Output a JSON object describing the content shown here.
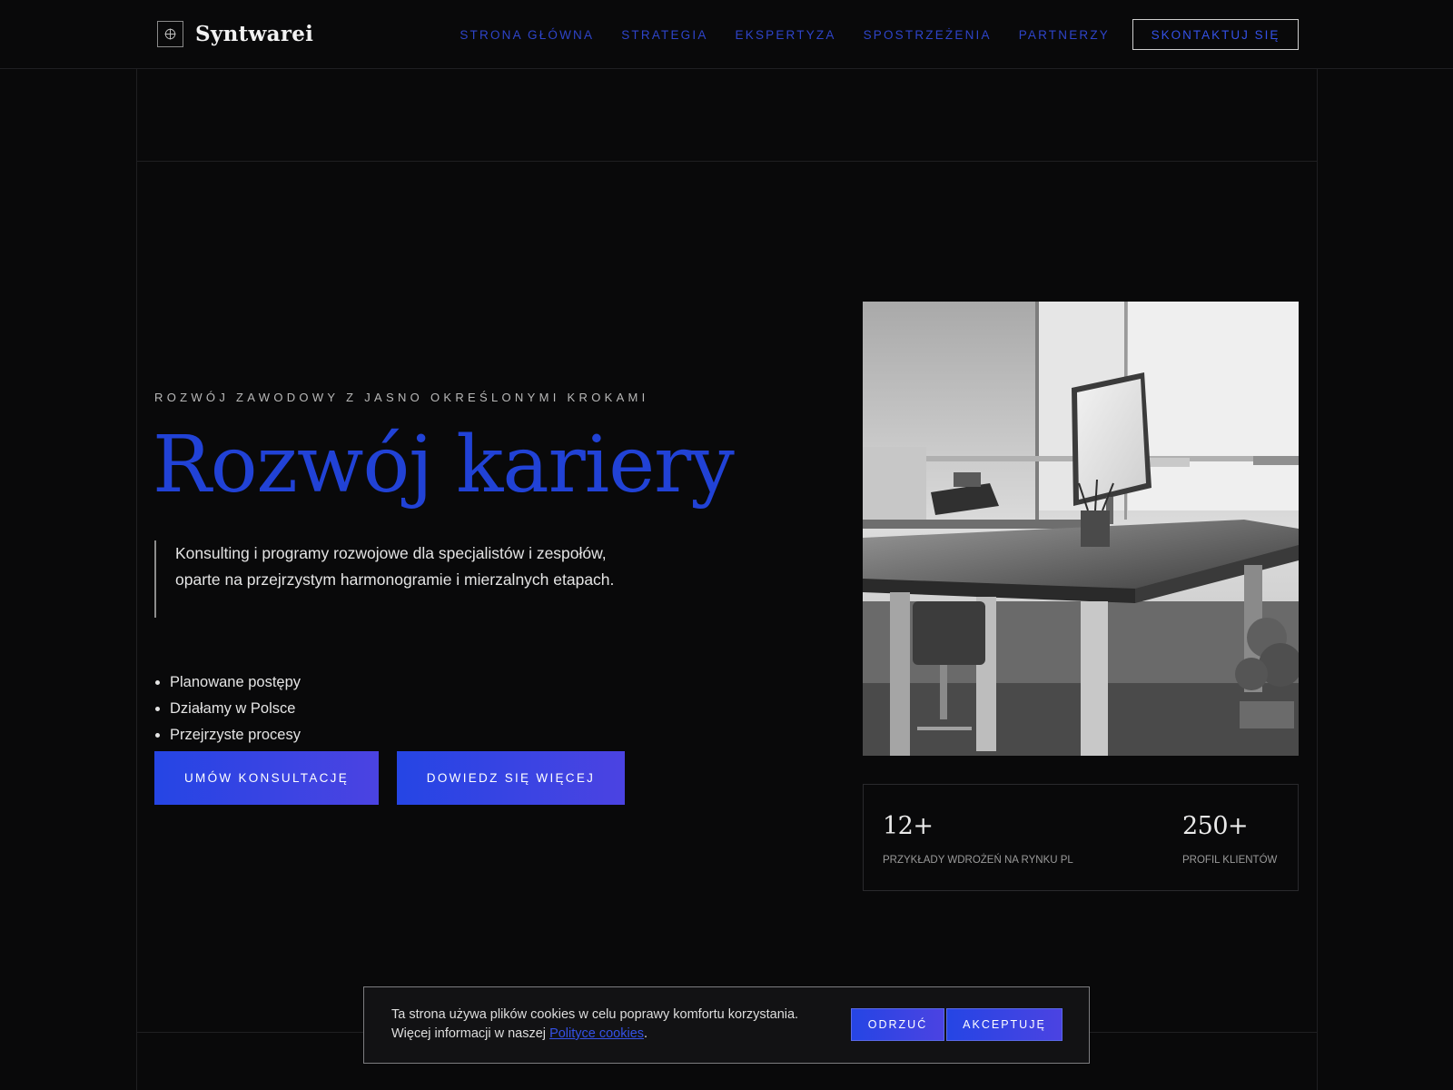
{
  "brand": {
    "name": "Syntwarei",
    "icon": "crosshair-icon"
  },
  "nav": {
    "items": [
      {
        "label": "STRONA GŁÓWNA"
      },
      {
        "label": "STRATEGIA"
      },
      {
        "label": "EKSPERTYZA"
      },
      {
        "label": "SPOSTRZEŻENIA"
      },
      {
        "label": "PARTNERZY"
      }
    ],
    "contact_label": "SKONTAKTUJ SIĘ"
  },
  "hero": {
    "eyebrow": "ROZWÓJ ZAWODOWY Z JASNO OKREŚLONYMI KROKAMI",
    "title": "Rozwój kariery",
    "lead": "Konsulting i programy rozwojowe dla specjalistów i zespołów, oparte na przejrzystym harmonogramie i mierzalnych etapach.",
    "bullets": [
      "Planowane postępy",
      "Działamy w Polsce",
      "Przejrzyste procesy"
    ],
    "primary_button": "UMÓW KONSULTACJĘ",
    "secondary_button": "DOWIEDZ SIĘ WIĘCEJ"
  },
  "stats": [
    {
      "value": "12+",
      "label": "PRZYKŁADY WDROŻEŃ NA RYNKU PL"
    },
    {
      "value": "250+",
      "label": "PROFIL KLIENTÓW"
    }
  ],
  "cookie": {
    "line1": "Ta strona używa plików cookies w celu poprawy komfortu korzystania.",
    "line2_prefix": "Więcej informacji w naszej ",
    "link": "Polityce cookies",
    "line2_suffix": ".",
    "reject_label": "ODRZUĆ",
    "accept_label": "AKCEPTUJĘ"
  },
  "colors": {
    "accent": "#2142d6",
    "button_gradient_start": "#2545e4",
    "button_gradient_end": "#4b43e2",
    "background": "#09090a"
  }
}
